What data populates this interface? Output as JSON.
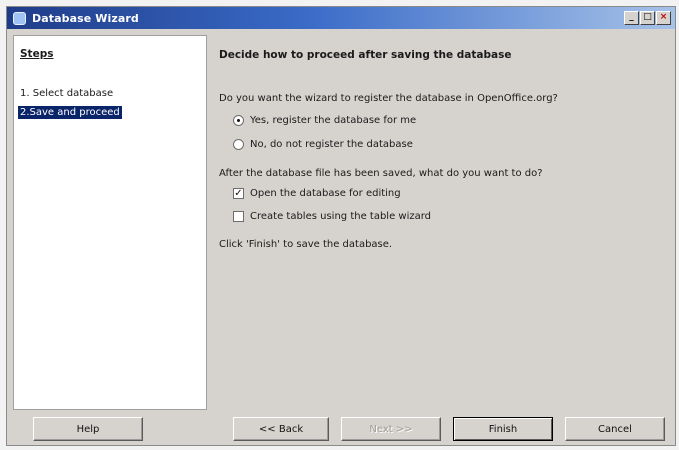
{
  "window": {
    "title": "Database Wizard",
    "controls": {
      "minimize": "_",
      "maximize": "□",
      "close": "×"
    }
  },
  "steps": {
    "title": "Steps",
    "items": [
      {
        "label": "1. Select database",
        "selected": false
      },
      {
        "label": "2.Save and proceed",
        "selected": true
      }
    ]
  },
  "main": {
    "heading": "Decide how to proceed after saving the database",
    "register_question": "Do you want the wizard to register the database in OpenOffice.org?",
    "register_options": [
      {
        "label": "Yes, register the database for me",
        "checked": true
      },
      {
        "label": "No, do not register the database",
        "checked": false
      }
    ],
    "after_question": "After the database file has been saved, what do you want to do?",
    "after_options": [
      {
        "label": "Open the database for editing",
        "checked": true
      },
      {
        "label": "Create tables using the table wizard",
        "checked": false
      }
    ],
    "hint": "Click 'Finish' to save the database."
  },
  "buttons": {
    "help": "Help",
    "back": "<< Back",
    "next": "Next >>",
    "finish": "Finish",
    "cancel": "Cancel"
  },
  "colors": {
    "titlebar_start": "#1f3c88",
    "selection": "#0a246a",
    "dialog_face": "#d6d3ce"
  },
  "icons": {
    "app": "database-icon",
    "minimize": "minimize-icon",
    "maximize": "maximize-icon",
    "close": "close-icon"
  }
}
